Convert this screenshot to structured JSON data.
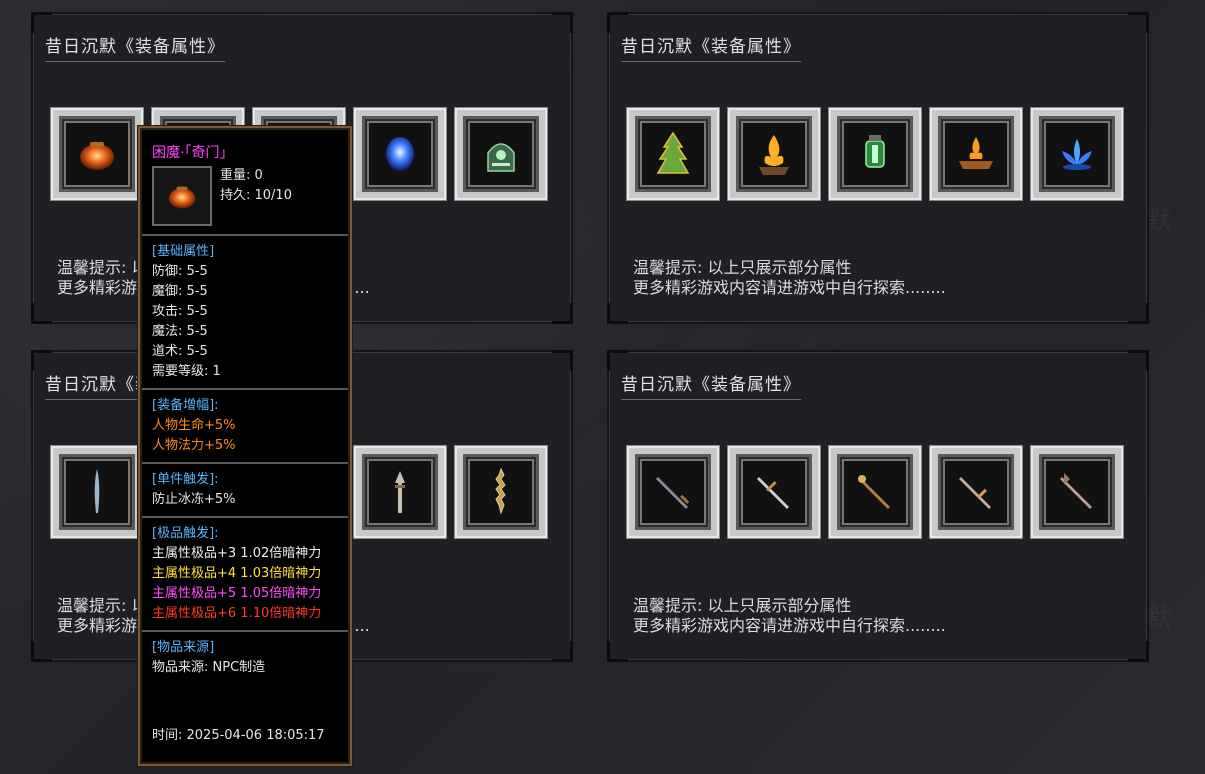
{
  "panels": [
    {
      "title": "昔日沉默《装备属性》",
      "tip_line1": "温馨提示: 以上只展示部分属性",
      "tip_line2": "更多精彩游戏内容请进游戏中自行探索........"
    },
    {
      "title": "昔日沉默《装备属性》",
      "tip_line1": "温馨提示: 以上只展示部分属性",
      "tip_line2": "更多精彩游戏内容请进游戏中自行探索........"
    },
    {
      "title": "昔日沉默《装备属性》",
      "tip_line1": "温馨提示: 以上只展示部分属性",
      "tip_line2": "更多精彩游戏内容请进游戏中自行探索........"
    },
    {
      "title": "昔日沉默《装备属性》",
      "tip_line1": "温馨提示: 以上只展示部分属性",
      "tip_line2": "更多精彩游戏内容请进游戏中自行探索........"
    }
  ],
  "tooltip": {
    "name": "困魔·「奇门」",
    "weight": "重量: 0",
    "durability": "持久: 10/10",
    "basic_header": "[基础属性]",
    "basic": [
      "防御: 5-5",
      "魔御: 5-5",
      "攻击: 5-5",
      "魔法: 5-5",
      "道术: 5-5",
      "需要等级: 1"
    ],
    "boost_header": "[装备增幅]:",
    "boost": [
      "人物生命+5%",
      "人物法力+5%"
    ],
    "trigger_header": "[单件触发]:",
    "trigger": [
      "防止冰冻+5%"
    ],
    "rare_header": "[极品触发]:",
    "rare": [
      "主属性极品+3 1.02倍暗神力",
      "主属性极品+4 1.03倍暗神力",
      "主属性极品+5 1.05倍暗神力",
      "主属性极品+6 1.10倍暗神力"
    ],
    "source_header": "[物品来源]",
    "source": "物品来源: NPC制造",
    "time": "时间: 2025-04-06 18:05:17"
  },
  "colors": {
    "tooltip_border": "#7a5a3a",
    "header_blue": "#57b5ff",
    "name_magenta": "#ff44ff"
  }
}
